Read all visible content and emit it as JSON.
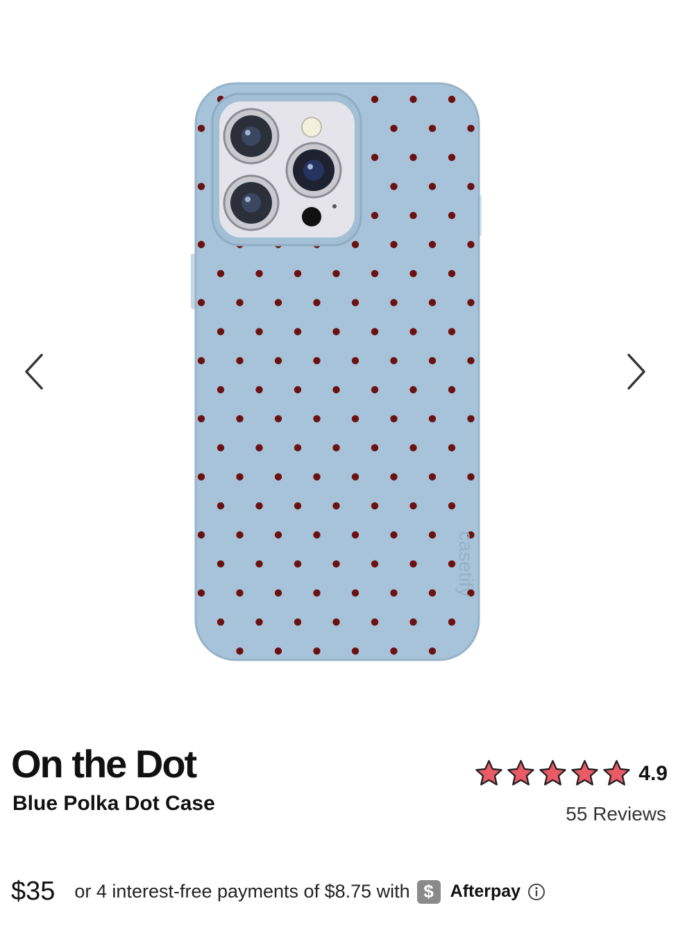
{
  "product": {
    "name": "On the Dot",
    "subtitle": "Blue Polka Dot Case",
    "price": "$35",
    "case_brand_mark": "casetify",
    "colors": {
      "case": "#a7c3d9",
      "dots": "#6b1111",
      "star": "#ec5a66"
    }
  },
  "rating": {
    "value": "4.9",
    "stars": 5,
    "reviews_label": "55 Reviews"
  },
  "payment": {
    "installments_text": "or 4 interest-free payments of $8.75 with",
    "badge_symbol": "$",
    "provider": "Afterpay"
  },
  "icons": {
    "prev": "chevron-left-icon",
    "next": "chevron-right-icon",
    "info": "info-icon"
  }
}
